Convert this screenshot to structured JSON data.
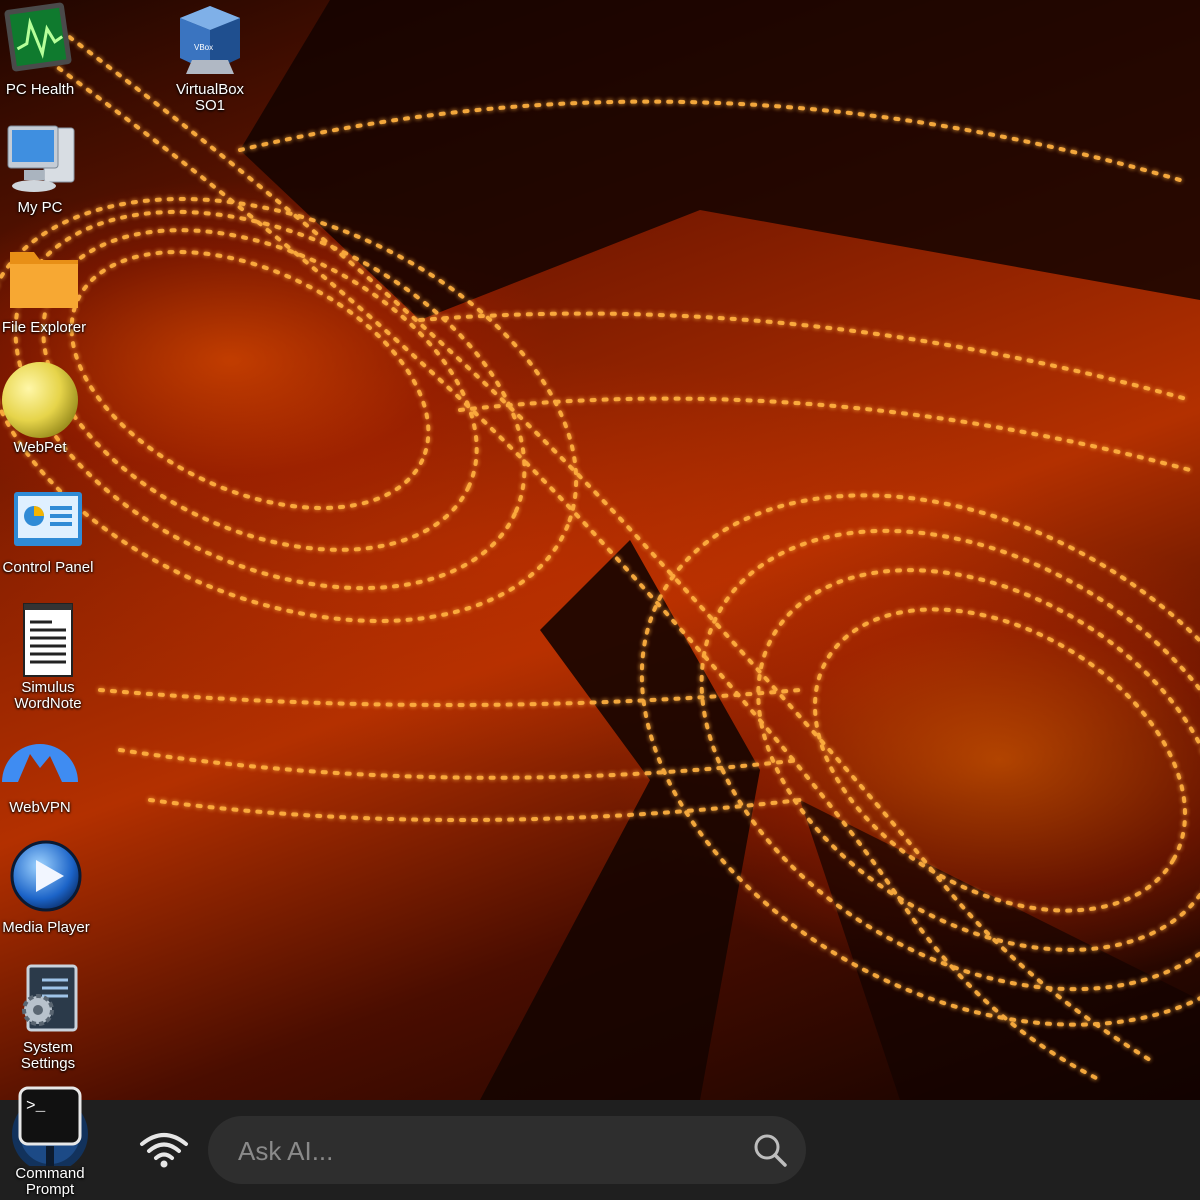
{
  "desktop": {
    "icons": [
      {
        "label": "PC Health",
        "icon": "pc-health-icon"
      },
      {
        "label": "VirtualBox\nSO1",
        "icon": "virtualbox-icon"
      },
      {
        "label": "My PC",
        "icon": "my-pc-icon"
      },
      {
        "label": "File Explorer",
        "icon": "folder-icon"
      },
      {
        "label": "WebPet",
        "icon": "webpet-ball-icon"
      },
      {
        "label": "Control Panel",
        "icon": "control-panel-icon"
      },
      {
        "label": "Simulus\nWordNote",
        "icon": "notepad-icon"
      },
      {
        "label": "WebVPN",
        "icon": "vpn-mountain-icon"
      },
      {
        "label": "Media Player",
        "icon": "play-icon"
      },
      {
        "label": "System\nSettings",
        "icon": "settings-gear-icon"
      },
      {
        "label": "Command\nPrompt",
        "icon": "terminal-icon"
      }
    ],
    "colors": {
      "accent": "#ff7a10",
      "wallpaper_dark": "#1a0500",
      "taskbar": "#1f1f1f"
    }
  },
  "taskbar": {
    "wifi_icon": "wifi-icon",
    "search": {
      "placeholder": "Ask AI...",
      "icon": "search-icon"
    }
  }
}
